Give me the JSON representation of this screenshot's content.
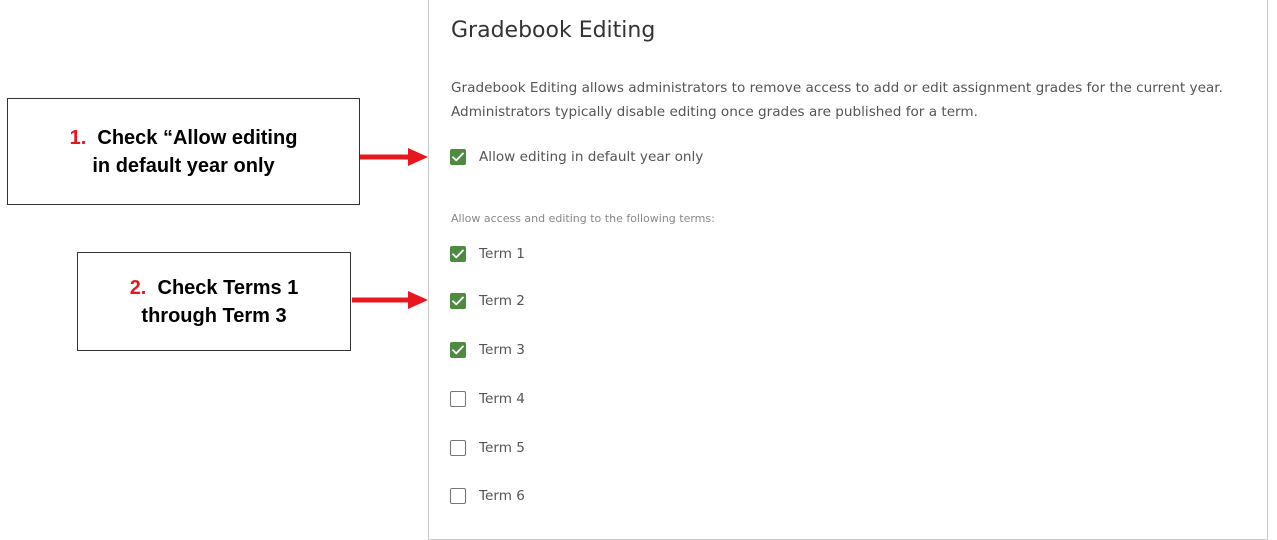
{
  "panel": {
    "title": "Gradebook Editing",
    "description": "Gradebook Editing allows administrators to remove access to add or edit assignment grades for the current year. Administrators typically disable editing once grades are published for a term.",
    "default_year_option": {
      "label": "Allow editing in default year only",
      "checked": true
    },
    "terms_section_label": "Allow access and editing to the following terms:",
    "terms": [
      {
        "label": "Term 1",
        "checked": true
      },
      {
        "label": "Term 2",
        "checked": true
      },
      {
        "label": "Term 3",
        "checked": true
      },
      {
        "label": "Term 4",
        "checked": false
      },
      {
        "label": "Term 5",
        "checked": false
      },
      {
        "label": "Term 6",
        "checked": false
      }
    ],
    "checkbox_checked_color": "#4f8a43"
  },
  "callouts": [
    {
      "number": "1.",
      "line1": "Check “Allow editing",
      "line2": "in default year only"
    },
    {
      "number": "2.",
      "line1": "Check Terms 1",
      "line2": "through Term 3"
    }
  ],
  "annotation_colors": {
    "arrow": "#e8171d",
    "number": "#e8171d"
  }
}
